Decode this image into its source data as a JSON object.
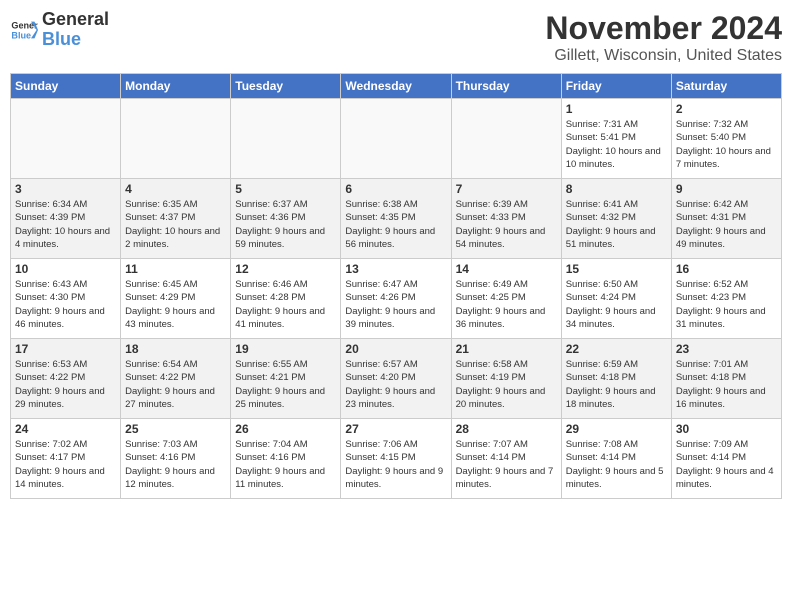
{
  "header": {
    "logo_line1": "General",
    "logo_line2": "Blue",
    "month": "November 2024",
    "location": "Gillett, Wisconsin, United States"
  },
  "weekdays": [
    "Sunday",
    "Monday",
    "Tuesday",
    "Wednesday",
    "Thursday",
    "Friday",
    "Saturday"
  ],
  "weeks": [
    [
      {
        "day": "",
        "info": ""
      },
      {
        "day": "",
        "info": ""
      },
      {
        "day": "",
        "info": ""
      },
      {
        "day": "",
        "info": ""
      },
      {
        "day": "",
        "info": ""
      },
      {
        "day": "1",
        "info": "Sunrise: 7:31 AM\nSunset: 5:41 PM\nDaylight: 10 hours and 10 minutes."
      },
      {
        "day": "2",
        "info": "Sunrise: 7:32 AM\nSunset: 5:40 PM\nDaylight: 10 hours and 7 minutes."
      }
    ],
    [
      {
        "day": "3",
        "info": "Sunrise: 6:34 AM\nSunset: 4:39 PM\nDaylight: 10 hours and 4 minutes."
      },
      {
        "day": "4",
        "info": "Sunrise: 6:35 AM\nSunset: 4:37 PM\nDaylight: 10 hours and 2 minutes."
      },
      {
        "day": "5",
        "info": "Sunrise: 6:37 AM\nSunset: 4:36 PM\nDaylight: 9 hours and 59 minutes."
      },
      {
        "day": "6",
        "info": "Sunrise: 6:38 AM\nSunset: 4:35 PM\nDaylight: 9 hours and 56 minutes."
      },
      {
        "day": "7",
        "info": "Sunrise: 6:39 AM\nSunset: 4:33 PM\nDaylight: 9 hours and 54 minutes."
      },
      {
        "day": "8",
        "info": "Sunrise: 6:41 AM\nSunset: 4:32 PM\nDaylight: 9 hours and 51 minutes."
      },
      {
        "day": "9",
        "info": "Sunrise: 6:42 AM\nSunset: 4:31 PM\nDaylight: 9 hours and 49 minutes."
      }
    ],
    [
      {
        "day": "10",
        "info": "Sunrise: 6:43 AM\nSunset: 4:30 PM\nDaylight: 9 hours and 46 minutes."
      },
      {
        "day": "11",
        "info": "Sunrise: 6:45 AM\nSunset: 4:29 PM\nDaylight: 9 hours and 43 minutes."
      },
      {
        "day": "12",
        "info": "Sunrise: 6:46 AM\nSunset: 4:28 PM\nDaylight: 9 hours and 41 minutes."
      },
      {
        "day": "13",
        "info": "Sunrise: 6:47 AM\nSunset: 4:26 PM\nDaylight: 9 hours and 39 minutes."
      },
      {
        "day": "14",
        "info": "Sunrise: 6:49 AM\nSunset: 4:25 PM\nDaylight: 9 hours and 36 minutes."
      },
      {
        "day": "15",
        "info": "Sunrise: 6:50 AM\nSunset: 4:24 PM\nDaylight: 9 hours and 34 minutes."
      },
      {
        "day": "16",
        "info": "Sunrise: 6:52 AM\nSunset: 4:23 PM\nDaylight: 9 hours and 31 minutes."
      }
    ],
    [
      {
        "day": "17",
        "info": "Sunrise: 6:53 AM\nSunset: 4:22 PM\nDaylight: 9 hours and 29 minutes."
      },
      {
        "day": "18",
        "info": "Sunrise: 6:54 AM\nSunset: 4:22 PM\nDaylight: 9 hours and 27 minutes."
      },
      {
        "day": "19",
        "info": "Sunrise: 6:55 AM\nSunset: 4:21 PM\nDaylight: 9 hours and 25 minutes."
      },
      {
        "day": "20",
        "info": "Sunrise: 6:57 AM\nSunset: 4:20 PM\nDaylight: 9 hours and 23 minutes."
      },
      {
        "day": "21",
        "info": "Sunrise: 6:58 AM\nSunset: 4:19 PM\nDaylight: 9 hours and 20 minutes."
      },
      {
        "day": "22",
        "info": "Sunrise: 6:59 AM\nSunset: 4:18 PM\nDaylight: 9 hours and 18 minutes."
      },
      {
        "day": "23",
        "info": "Sunrise: 7:01 AM\nSunset: 4:18 PM\nDaylight: 9 hours and 16 minutes."
      }
    ],
    [
      {
        "day": "24",
        "info": "Sunrise: 7:02 AM\nSunset: 4:17 PM\nDaylight: 9 hours and 14 minutes."
      },
      {
        "day": "25",
        "info": "Sunrise: 7:03 AM\nSunset: 4:16 PM\nDaylight: 9 hours and 12 minutes."
      },
      {
        "day": "26",
        "info": "Sunrise: 7:04 AM\nSunset: 4:16 PM\nDaylight: 9 hours and 11 minutes."
      },
      {
        "day": "27",
        "info": "Sunrise: 7:06 AM\nSunset: 4:15 PM\nDaylight: 9 hours and 9 minutes."
      },
      {
        "day": "28",
        "info": "Sunrise: 7:07 AM\nSunset: 4:14 PM\nDaylight: 9 hours and 7 minutes."
      },
      {
        "day": "29",
        "info": "Sunrise: 7:08 AM\nSunset: 4:14 PM\nDaylight: 9 hours and 5 minutes."
      },
      {
        "day": "30",
        "info": "Sunrise: 7:09 AM\nSunset: 4:14 PM\nDaylight: 9 hours and 4 minutes."
      }
    ]
  ]
}
